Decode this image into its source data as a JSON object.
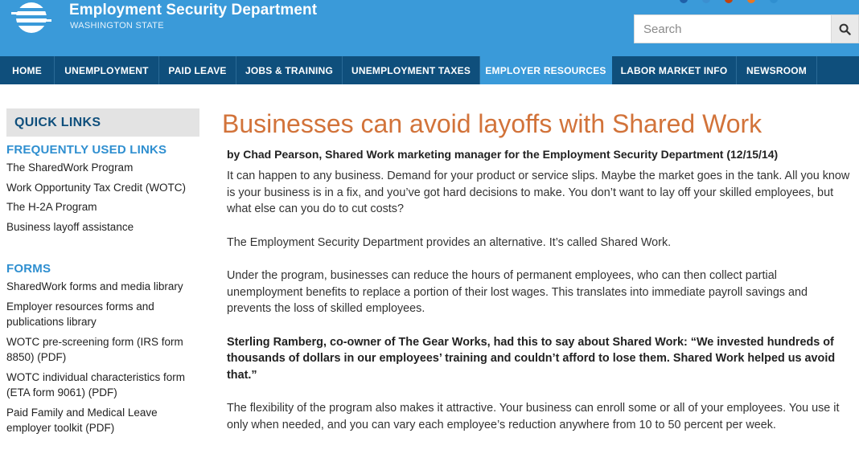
{
  "header": {
    "title": "Employment Security Department",
    "subtitle": "WASHINGTON STATE",
    "search_placeholder": "Search",
    "brand_color": "#3a9ad9",
    "nav_color": "#0f4f7c"
  },
  "nav": {
    "items": [
      {
        "label": "HOME"
      },
      {
        "label": "UNEMPLOYMENT"
      },
      {
        "label": "PAID LEAVE"
      },
      {
        "label": "JOBS & TRAINING"
      },
      {
        "label": "UNEMPLOYMENT TAXES"
      },
      {
        "label": "EMPLOYER RESOURCES"
      },
      {
        "label": "LABOR MARKET INFO"
      },
      {
        "label": "NEWSROOM"
      }
    ],
    "active": "EMPLOYER RESOURCES"
  },
  "sidebar": {
    "heading": "QUICK LINKS",
    "frequent": {
      "title": "FREQUENTLY USED LINKS",
      "links": [
        "The SharedWork Program",
        "Work Opportunity Tax Credit (WOTC)",
        "The H-2A Program",
        "Business layoff assistance"
      ]
    },
    "forms": {
      "title": "FORMS",
      "links": [
        "SharedWork forms and media library",
        "Employer resources forms and publications library",
        "WOTC pre-screening form (IRS form 8850) (PDF)",
        "WOTC individual characteristics form (ETA form 9061) (PDF)",
        "Paid Family and Medical Leave employer toolkit (PDF)"
      ]
    }
  },
  "article": {
    "title": "Businesses can avoid layoffs with Shared Work",
    "byline": "by Chad Pearson, Shared Work marketing manager for the Employment Security Department (12/15/14)",
    "paragraphs": [
      "It can happen to any business. Demand for your product or service slips. Maybe the market goes in the tank. All you know is your business is in a fix, and you’ve got hard decisions to make. You don’t want to lay off your skilled employees, but what else can you do to cut costs?",
      "The Employment Security Department provides an alternative.  It’s called Shared Work.",
      "Under the program, businesses can reduce the hours of permanent employees, who can then collect partial unemployment benefits to replace a portion of their lost wages. This translates into immediate payroll savings and prevents the loss of skilled employees.",
      "Sterling Ramberg, co-owner of The Gear Works, had this to say about Shared Work: “We invested hundreds of thousands of dollars in our employees’ training and couldn’t afford to lose them.  Shared Work helped us avoid that.”",
      "The flexibility of the program also makes it attractive. Your business can enroll some or all of your employees. You use it only when needed, and you can vary each employee’s reduction anywhere from 10 to 50 percent per week."
    ]
  }
}
